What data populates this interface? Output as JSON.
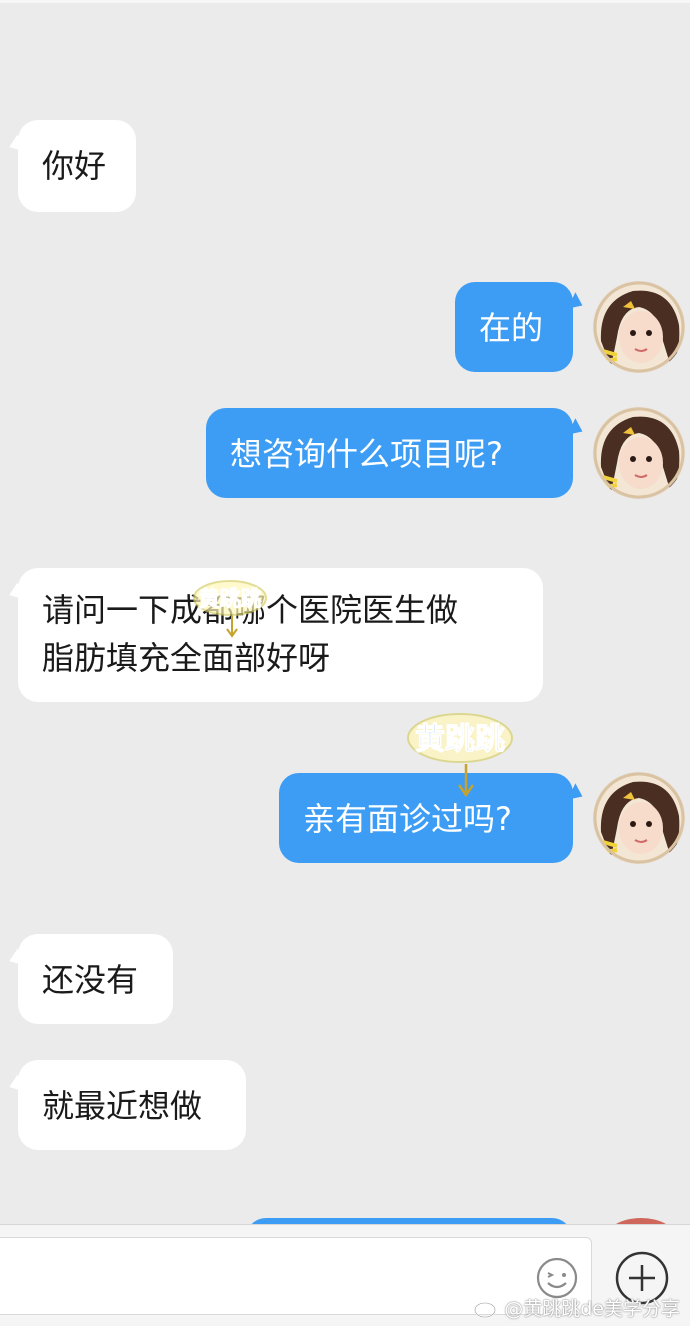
{
  "messages": [
    {
      "side": "in",
      "text": "你好"
    },
    {
      "side": "out",
      "text": "在的"
    },
    {
      "side": "out",
      "text": "想咨询什么项目呢?"
    },
    {
      "side": "in",
      "line1": "请问一下成都哪个医院医生做",
      "line2": "脂肪填充全面部好呀"
    },
    {
      "side": "out",
      "text": "亲有面诊过吗?"
    },
    {
      "side": "in",
      "text": "还没有"
    },
    {
      "side": "in",
      "text": "就最近想做"
    }
  ],
  "watermark": {
    "stamp_text": "黄跳跳",
    "footer_text": "@黄跳跳de美学分享"
  },
  "input_bar": {
    "emoji_icon": "smiley-icon",
    "add_icon": "plus-circle-icon"
  },
  "colors": {
    "background": "#ebebeb",
    "incoming_bubble": "#ffffff",
    "outgoing_bubble": "#3d9df5"
  }
}
